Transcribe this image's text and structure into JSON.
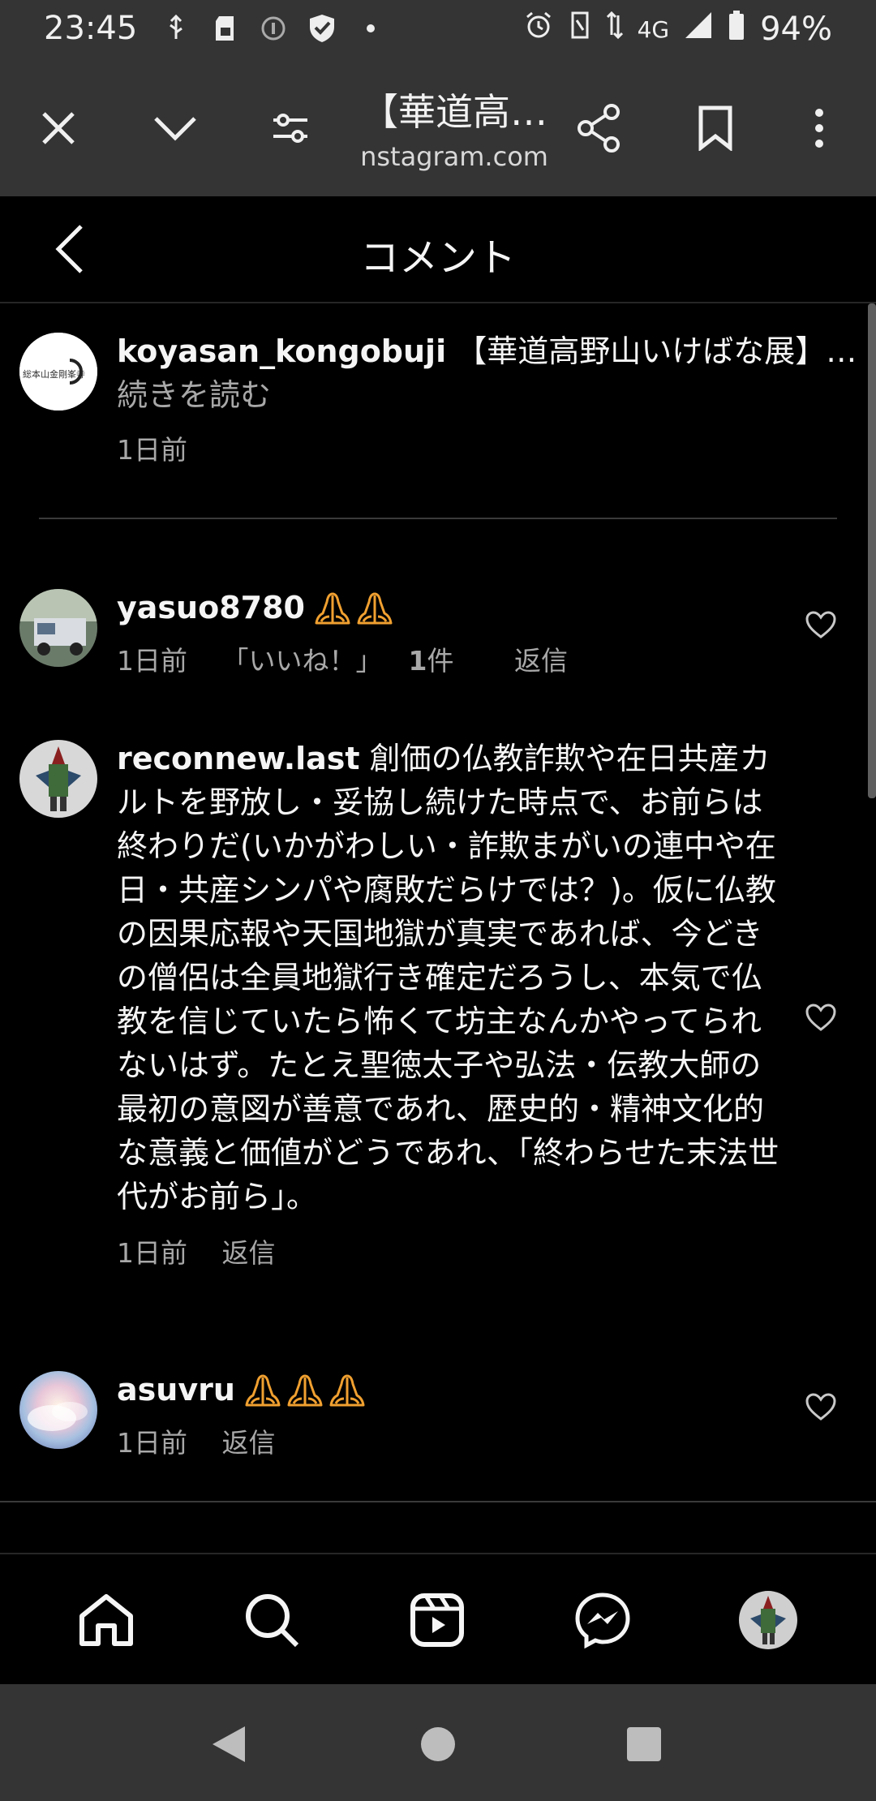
{
  "status_bar": {
    "time": "23:45",
    "network": "4G",
    "battery": "94%",
    "icons": [
      "usb-icon",
      "sd-card-icon",
      "info-icon",
      "shield-icon",
      "dot-icon",
      "alarm-icon",
      "vibrate-icon",
      "data-icon",
      "signal-icon",
      "battery-icon"
    ]
  },
  "browser": {
    "page_title": "【華道高…",
    "domain": "nstagram.com",
    "icons": [
      "close-icon",
      "chevron-down-icon",
      "settings-sliders-icon",
      "share-icon",
      "bookmark-icon",
      "more-vert-icon"
    ]
  },
  "header": {
    "title": "コメント",
    "back_icon": "chevron-left-icon"
  },
  "caption": {
    "username": "koyasan_kongobuji",
    "text": " 【華道高野山いけばな展】…",
    "read_more": "続きを読む",
    "time": "1日前"
  },
  "comments": [
    {
      "username": "yasuo8780",
      "text": "",
      "emoji_count": 2,
      "time": "1日前",
      "likes": "「いいね！」1件",
      "likes_count": "1",
      "likes_prefix": "「いいね！」",
      "likes_suffix": "件",
      "reply": "返信"
    },
    {
      "username": "reconnew.last",
      "text": " 創価の仏教詐欺や在日共産カルトを野放し・妥協し続けた時点で、お前らは終わりだ(いかがわしい・詐欺まがいの連中や在日・共産シンパや腐敗だらけでは？)。仮に仏教の因果応報や天国地獄が真実であれば、今どきの僧侶は全員地獄行き確定だろうし、本気で仏教を信じていたら怖くて坊主なんかやってられないはず。たとえ聖徳太子や弘法・伝教大師の最初の意図が善意であれ、歴史的・精神文化的な意義と価値がどうであれ、「終わらせた末法世代がお前ら」。",
      "time": "1日前",
      "reply": "返信"
    },
    {
      "username": "asuvru",
      "text": "",
      "emoji_count": 3,
      "time": "1日前",
      "reply": "返信"
    }
  ],
  "bottom_nav": [
    "home-icon",
    "search-icon",
    "reels-icon",
    "messenger-icon",
    "profile-avatar"
  ],
  "colors": {
    "background": "#000000",
    "chrome": "#343434",
    "meta_text": "#a8a8a8",
    "emoji": "#f0a030"
  }
}
